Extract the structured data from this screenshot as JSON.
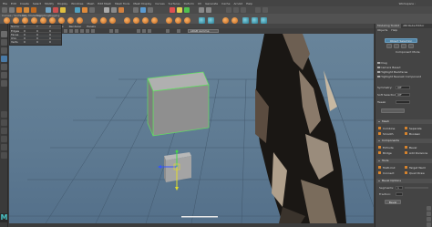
{
  "menubar": {
    "items": [
      "File",
      "Edit",
      "Create",
      "Select",
      "Modify",
      "Display",
      "Windows",
      "Mesh",
      "Edit Mesh",
      "Mesh Tools",
      "Mesh Display",
      "Curves",
      "Surfaces",
      "Deform",
      "UV",
      "Generate",
      "Cache",
      "Arnold",
      "Help"
    ],
    "workspace": "Workspace :"
  },
  "shelf_tabs": [
    "Curves / Surfaces",
    "Poly Modeling",
    "Sculpting",
    "Rigging"
  ],
  "viewport": {
    "menu": [
      "View",
      "Shading",
      "Lighting",
      "Show",
      "Renderer",
      "Panels"
    ],
    "colorspace": "sRGB gamma"
  },
  "outliner": {
    "headers": [
      "Name",
      "X",
      "Y",
      "Z"
    ],
    "rows": [
      [
        "Edges",
        "0",
        "0",
        "0"
      ],
      [
        "Faces",
        "0",
        "0",
        "0"
      ],
      [
        "UVs",
        "0",
        "0",
        "0"
      ],
      [
        "Verts",
        "0",
        "0",
        "0"
      ]
    ]
  },
  "toolkit": {
    "tabs": [
      "Modeling Toolkit",
      "Attribute Editor"
    ],
    "menu": [
      "Objects",
      "Help"
    ],
    "object_mode": "Object Selection",
    "mode_label": "Component Mode",
    "options": [
      "Drag",
      "Camera Based",
      "Highlight Backfaces",
      "Highlight Nearest Component"
    ],
    "symmetry_label": "Symmetry:",
    "symmetry_value": "Off",
    "soft_select_label": "Soft Selection",
    "soft_select_value": "Off",
    "tweak_label": "Tweak",
    "sections": {
      "mesh": "Mesh",
      "components": "Components",
      "tools": "Tools",
      "bevel_options": "Bevel Options"
    },
    "mesh_buttons": [
      "Combine",
      "Separate",
      "Smooth",
      "Boolean"
    ],
    "component_buttons": [
      "Extrude",
      "Bevel",
      "Bridge",
      "Add Divisions"
    ],
    "tool_buttons": [
      "Multi-Cut",
      "Target Weld",
      "Connect",
      "Quad Draw"
    ],
    "segments_label": "Segments:",
    "segments_value": "1",
    "offset_label": "Fraction:",
    "bevel_button": "Bevel"
  },
  "colors": {
    "accent": "#5285a6",
    "viewport_bg": "#6482a0",
    "cube_grey": "#9a9a9a",
    "selection_green": "#5fe05f",
    "logo_teal": "#4ac2c5"
  }
}
